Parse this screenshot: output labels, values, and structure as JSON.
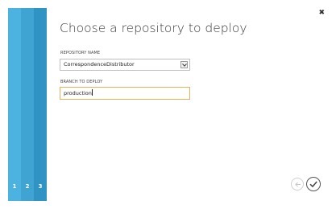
{
  "wizard": {
    "title": "Choose a repository to deploy",
    "close_icon": "close-icon",
    "steps": [
      {
        "label": "1",
        "color": "#4cb3e0"
      },
      {
        "label": "2",
        "color": "#3fa4d2"
      },
      {
        "label": "3",
        "color": "#2f94c3"
      }
    ],
    "current_step": 3
  },
  "form": {
    "repository_label": "REPOSITORY NAME",
    "repository_value": "CorrespondenceDistributor",
    "branch_label": "BRANCH TO DEPLOY",
    "branch_value": "production"
  },
  "footer": {
    "back_icon": "back-arrow-icon",
    "complete_icon": "checkmark-icon"
  },
  "colors": {
    "input_focus_border": "#e0b45a"
  }
}
